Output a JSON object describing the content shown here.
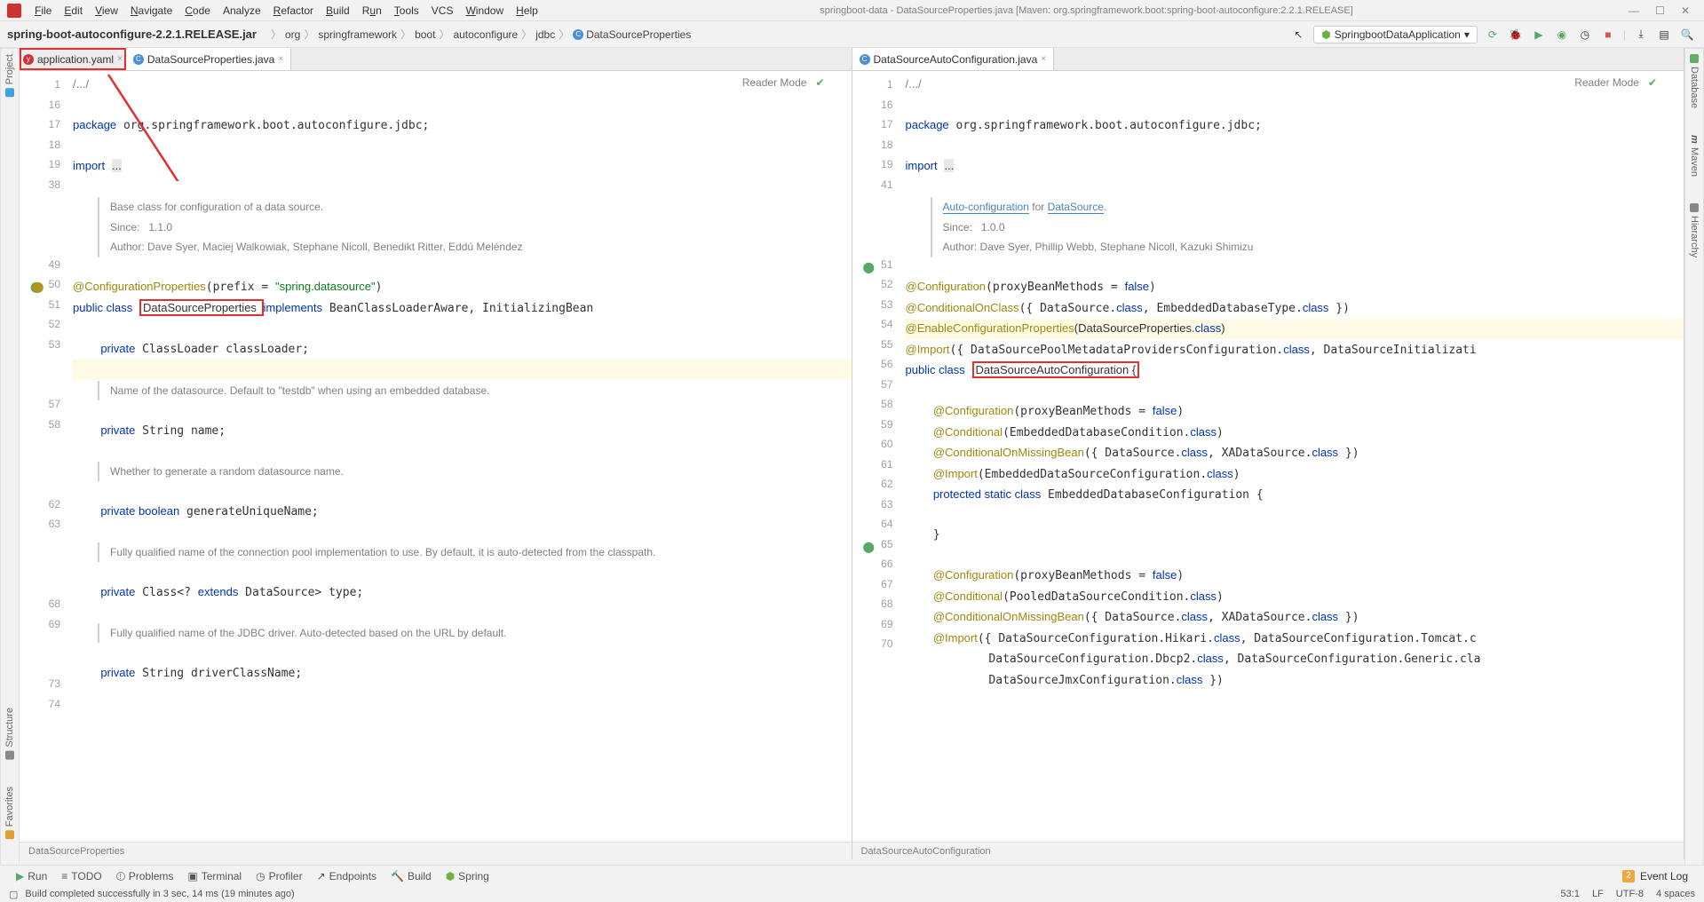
{
  "menu": {
    "items": [
      "File",
      "Edit",
      "View",
      "Navigate",
      "Code",
      "Analyze",
      "Refactor",
      "Build",
      "Run",
      "Tools",
      "VCS",
      "Window",
      "Help"
    ],
    "title": "springboot-data - DataSourceProperties.java [Maven: org.springframework.boot:spring-boot-autoconfigure:2.2.1.RELEASE]"
  },
  "breadcrumb": {
    "jar": "spring-boot-autoconfigure-2.2.1.RELEASE.jar",
    "parts": [
      "org",
      "springframework",
      "boot",
      "autoconfigure",
      "jdbc",
      "DataSourceProperties"
    ]
  },
  "runcfg": "SpringbootDataApplication",
  "leftTools": [
    "Project",
    "Structure",
    "Favorites"
  ],
  "rightTools": [
    "Database",
    "Maven",
    "Hierarchy"
  ],
  "pane1": {
    "tabs": [
      {
        "label": "application.yaml",
        "kind": "yaml"
      },
      {
        "label": "DataSourceProperties.java",
        "kind": "java"
      }
    ],
    "reader": "Reader Mode",
    "lines": [
      "1",
      "16",
      "17",
      "18",
      "19",
      "38",
      "",
      "",
      "",
      "49",
      "50",
      "51",
      "52",
      "53",
      "",
      "",
      "57",
      "58",
      "",
      "",
      "",
      "62",
      "63",
      "",
      "",
      "",
      "68",
      "69",
      "",
      "",
      "73",
      "74"
    ],
    "structCrumb": "DataSourceProperties",
    "doc1": {
      "a": "Base class for configuration of a data source.",
      "b": "Since:",
      "c": "1.1.0",
      "d": "Author: Dave Syer, Maciej Walkowiak, Stephane Nicoll, Benedikt Ritter, Eddú Meléndez"
    },
    "doc2": "Name of the datasource. Default to \"testdb\" when using an embedded database.",
    "doc3": "Whether to generate a random datasource name.",
    "doc4": "Fully qualified name of the connection pool implementation to use. By default, it is auto-detected from the classpath.",
    "doc5": "Fully qualified name of the JDBC driver. Auto-detected based on the URL by default."
  },
  "pane2": {
    "tabs": [
      {
        "label": "DataSourceAutoConfiguration.java",
        "kind": "java"
      }
    ],
    "reader": "Reader Mode",
    "lines": [
      "1",
      "16",
      "17",
      "18",
      "19",
      "41",
      "",
      "",
      "",
      "51",
      "52",
      "53",
      "54",
      "55",
      "56",
      "57",
      "58",
      "59",
      "60",
      "61",
      "62",
      "63",
      "64",
      "65",
      "66",
      "67",
      "68",
      "69",
      "70"
    ],
    "structCrumb": "DataSourceAutoConfiguration",
    "doc1": {
      "a1": "Auto-configuration",
      "a2": " for ",
      "a3": "DataSource",
      "a4": ".",
      "b": "Since:",
      "c": "1.0.0",
      "d": "Author: Dave Syer, Phillip Webb, Stephane Nicoll, Kazuki Shimizu"
    }
  },
  "bottom": {
    "tools": [
      "Run",
      "TODO",
      "Problems",
      "Terminal",
      "Profiler",
      "Endpoints",
      "Build",
      "Spring"
    ],
    "eventLog": "Event Log",
    "eventCount": "2"
  },
  "status": {
    "msg": "Build completed successfully in 3 sec, 14 ms (19 minutes ago)",
    "pos": "53:1",
    "lf": "LF",
    "enc": "UTF-8",
    "indent": "4 spaces"
  }
}
